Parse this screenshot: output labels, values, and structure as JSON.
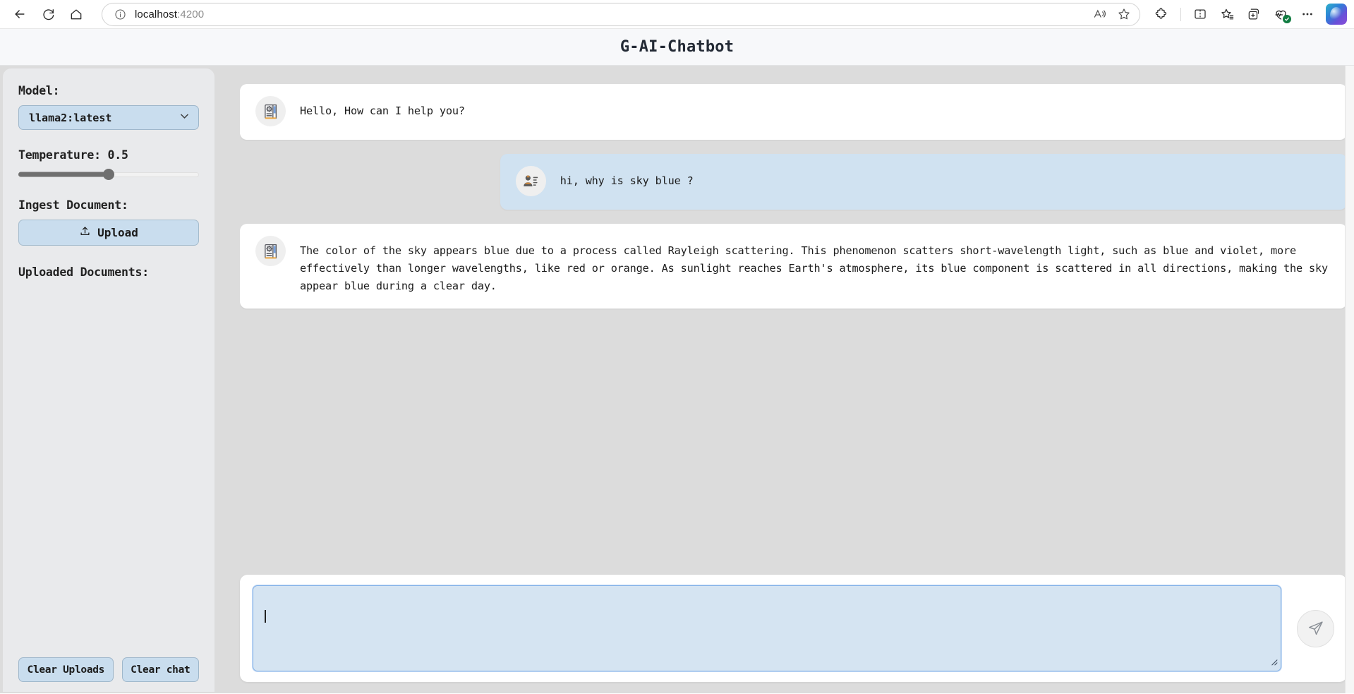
{
  "browser": {
    "back_label": "Back",
    "refresh_label": "Refresh",
    "home_label": "Home",
    "site_info_label": "View site information",
    "url_text": "localhost",
    "url_port": ":4200",
    "read_aloud_label": "Read aloud",
    "favorite_label": "Add this page to favorites",
    "extensions_label": "Extensions",
    "split_screen_label": "Split screen",
    "favorites_label": "Favorites",
    "collections_label": "Collections",
    "browser_essentials_label": "Browser essentials",
    "settings_more_label": "Settings and more",
    "copilot_label": "Copilot"
  },
  "app": {
    "title": "G-AI-Chatbot"
  },
  "sidebar": {
    "model_label": "Model:",
    "model_value": "llama2:latest",
    "model_options": [
      "llama2:latest"
    ],
    "temperature_label": "Temperature: 0.5",
    "temperature_value": 0.5,
    "temperature_percent": 50,
    "ingest_label": "Ingest Document:",
    "upload_button": "Upload",
    "uploaded_label": "Uploaded Documents:",
    "uploaded_documents": [],
    "clear_uploads_button": "Clear Uploads",
    "clear_chat_button": "Clear chat"
  },
  "chat": {
    "messages": [
      {
        "role": "bot",
        "avatar_icon": "book-gear-icon",
        "text": "Hello, How can I help you?"
      },
      {
        "role": "user",
        "avatar_icon": "contact-card-icon",
        "text": "hi, why is sky blue ?"
      },
      {
        "role": "bot",
        "avatar_icon": "book-gear-icon",
        "text": "The color of the sky appears blue due to a process called Rayleigh scattering. This phenomenon scatters short-wavelength light, such as blue and violet, more effectively than longer wavelengths, like red or orange. As sunlight reaches Earth's atmosphere, its blue component is scattered in all directions, making the sky appear blue during a clear day."
      }
    ]
  },
  "composer": {
    "input_value": "",
    "input_placeholder": "",
    "send_label": "Send"
  },
  "colors": {
    "accent_blue": "#c9ddee",
    "user_bubble": "#d0e2f1",
    "body_bg": "#dcdcdc",
    "sidebar_bg": "#e9eaec",
    "header_bg": "#f7f8fa",
    "input_bg": "#d5e4f2",
    "input_border": "#84b2e8"
  }
}
